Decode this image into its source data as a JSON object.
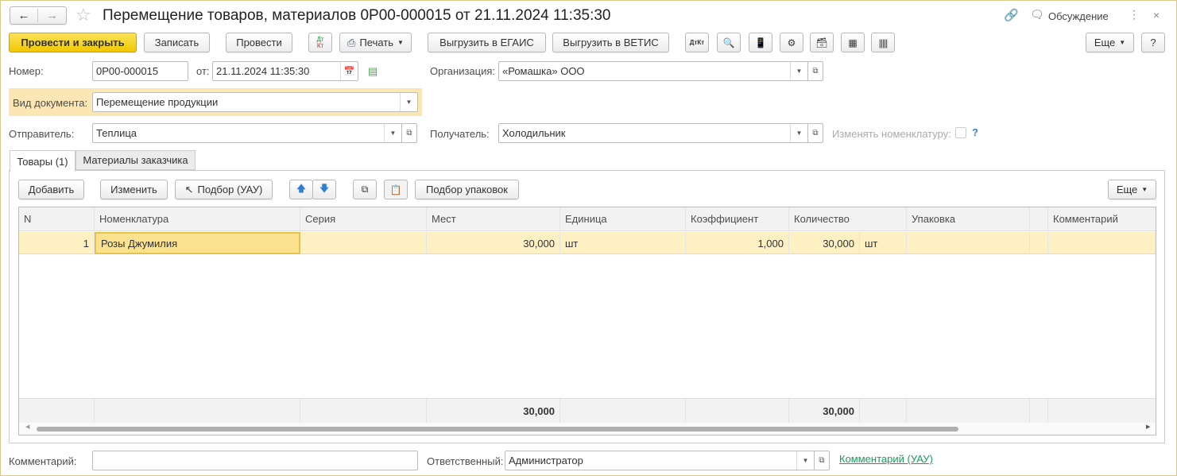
{
  "title": "Перемещение товаров, материалов 0Р00-000015 от 21.11.2024 11:35:30",
  "header": {
    "discussion": "Обсуждение"
  },
  "toolbar": {
    "post_close": "Провести и закрыть",
    "save": "Записать",
    "post": "Провести",
    "dtkt": "Дт Кт",
    "print": "Печать",
    "egais": "Выгрузить в ЕГАИС",
    "vetis": "Выгрузить в ВЕТИС",
    "more": "Еще",
    "help": "?"
  },
  "form": {
    "number_label": "Номер:",
    "number": "0Р00-000015",
    "date_label": "от:",
    "date": "21.11.2024 11:35:30",
    "org_label": "Организация:",
    "org": "«Ромашка» ООО",
    "doctype_label": "Вид документа:",
    "doctype": "Перемещение продукции",
    "sender_label": "Отправитель:",
    "sender": "Теплица",
    "receiver_label": "Получатель:",
    "receiver": "Холодильник",
    "change_nom_label": "Изменять номенклатуру:",
    "change_nom_checked": false,
    "help": "?"
  },
  "tabs": [
    {
      "label": "Товары (1)",
      "active": true
    },
    {
      "label": "Материалы заказчика",
      "active": false
    }
  ],
  "table_toolbar": {
    "add": "Добавить",
    "edit": "Изменить",
    "pick": "Подбор (УАУ)",
    "pick_packs": "Подбор упаковок",
    "more": "Еще"
  },
  "table": {
    "columns": [
      "N",
      "Номенклатура",
      "Серия",
      "Мест",
      "Единица",
      "Коэффициент",
      "Количество",
      "",
      "Упаковка",
      "",
      "Комментарий"
    ],
    "rows": [
      {
        "n": "1",
        "nom": "Розы Джумилия",
        "series": "",
        "places": "30,000",
        "unit": "шт",
        "coef": "1,000",
        "qty": "30,000",
        "qty_unit": "шт",
        "pack": "",
        "comment": ""
      }
    ],
    "totals": {
      "places": "30,000",
      "qty": "30,000"
    }
  },
  "footer": {
    "comment_label": "Комментарий:",
    "comment": "",
    "resp_label": "Ответственный:",
    "resp": "Администратор",
    "link": "Комментарий (УАУ)"
  },
  "colors": {
    "accent": "#f0c800",
    "selected_row": "#fdf0c2",
    "link": "#1a9c5b"
  }
}
